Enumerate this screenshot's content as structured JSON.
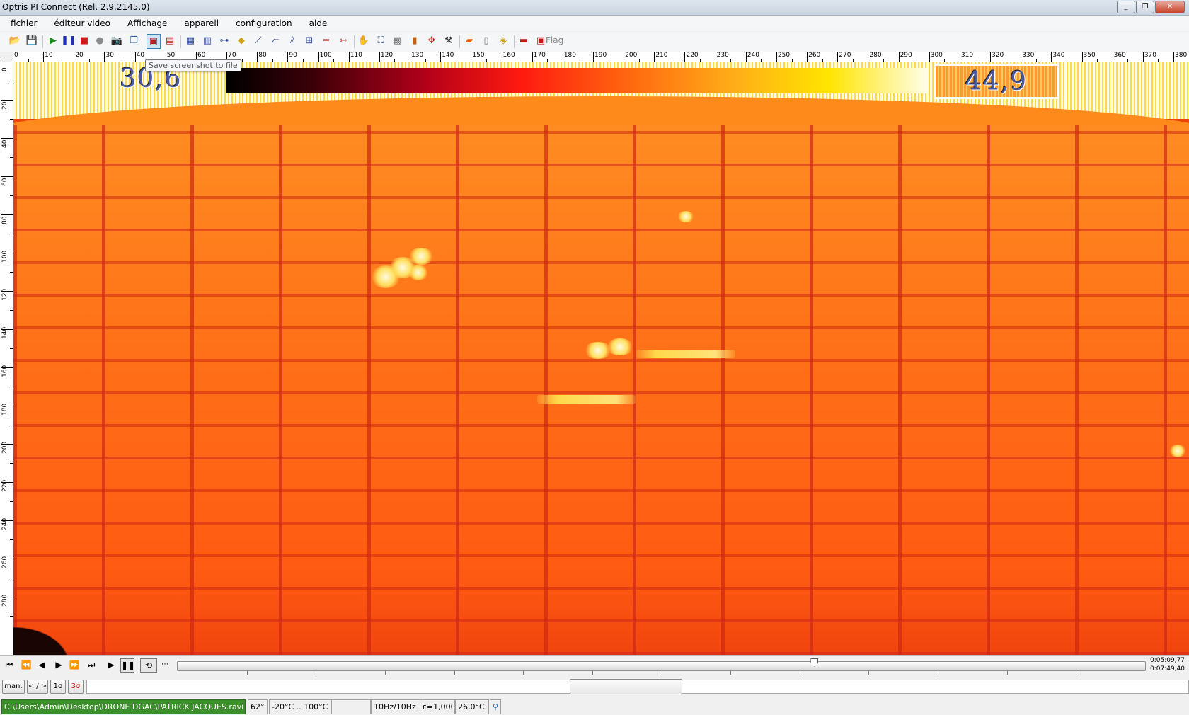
{
  "window": {
    "title": "Optris PI Connect (Rel. 2.9.2145.0)",
    "buttons": {
      "minimize": "_",
      "restore": "❐",
      "close": "✕"
    }
  },
  "menu": [
    "fichier",
    "éditeur video",
    "Affichage",
    "appareil",
    "configuration",
    "aide"
  ],
  "toolbar": {
    "flag_label": "Flag",
    "tooltip": "Save screenshot to file"
  },
  "ruler_top": [
    "0",
    "10",
    "20",
    "30",
    "40",
    "50",
    "60",
    "70",
    "80",
    "90",
    "100",
    "110",
    "120",
    "130",
    "140",
    "150",
    "160",
    "170",
    "180",
    "190",
    "200",
    "210",
    "220",
    "230",
    "240",
    "250",
    "260",
    "270",
    "280",
    "290",
    "300",
    "310",
    "320",
    "330",
    "340",
    "350",
    "360",
    "370",
    "380"
  ],
  "ruler_left": [
    "0",
    "20",
    "40",
    "60",
    "80",
    "100",
    "120",
    "140",
    "160",
    "180",
    "200",
    "220",
    "240",
    "260",
    "280"
  ],
  "thermal": {
    "temp_min": "30,6",
    "temp_max": "44,9"
  },
  "playback": {
    "time_current": "0:05:09,77",
    "time_total": "0:07:49,40",
    "position_fraction": 0.658
  },
  "lower_buttons": {
    "man": "man.",
    "nav": "< / >",
    "one_sigma": "1σ",
    "three_sigma": "3σ"
  },
  "status": {
    "file_path": "C:\\Users\\Admin\\Desktop\\DRONE DGAC\\PATRICK JACQUES.ravi",
    "fov": "62°",
    "range": "-20°C .. 100°C",
    "blank": "",
    "frequency": "10Hz/10Hz",
    "emissivity": "ε=1,000",
    "ambient": "26,0°C"
  },
  "colors": {
    "path_bg": "#3b8f2a",
    "tooltip_text": "#555555"
  }
}
